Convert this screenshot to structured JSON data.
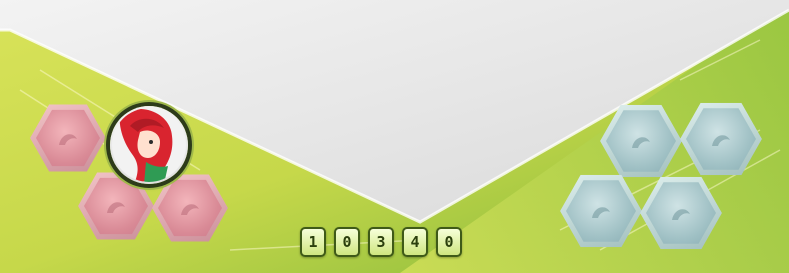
{
  "board": {
    "left_team": {
      "color": "#e2a1aa",
      "hex_slots": [
        "empty",
        "player",
        "empty",
        "empty"
      ]
    },
    "right_team": {
      "color": "#a9c8c8",
      "hex_slots": [
        "empty",
        "empty",
        "empty",
        "empty"
      ]
    },
    "accent_color": "#b9cf3a"
  },
  "counter": {
    "digits": [
      "1",
      "0",
      "3",
      "4",
      "0"
    ]
  },
  "icons": {
    "player_avatar": "red-haired-character-icon",
    "empty_slot": "empty-slot-icon"
  }
}
